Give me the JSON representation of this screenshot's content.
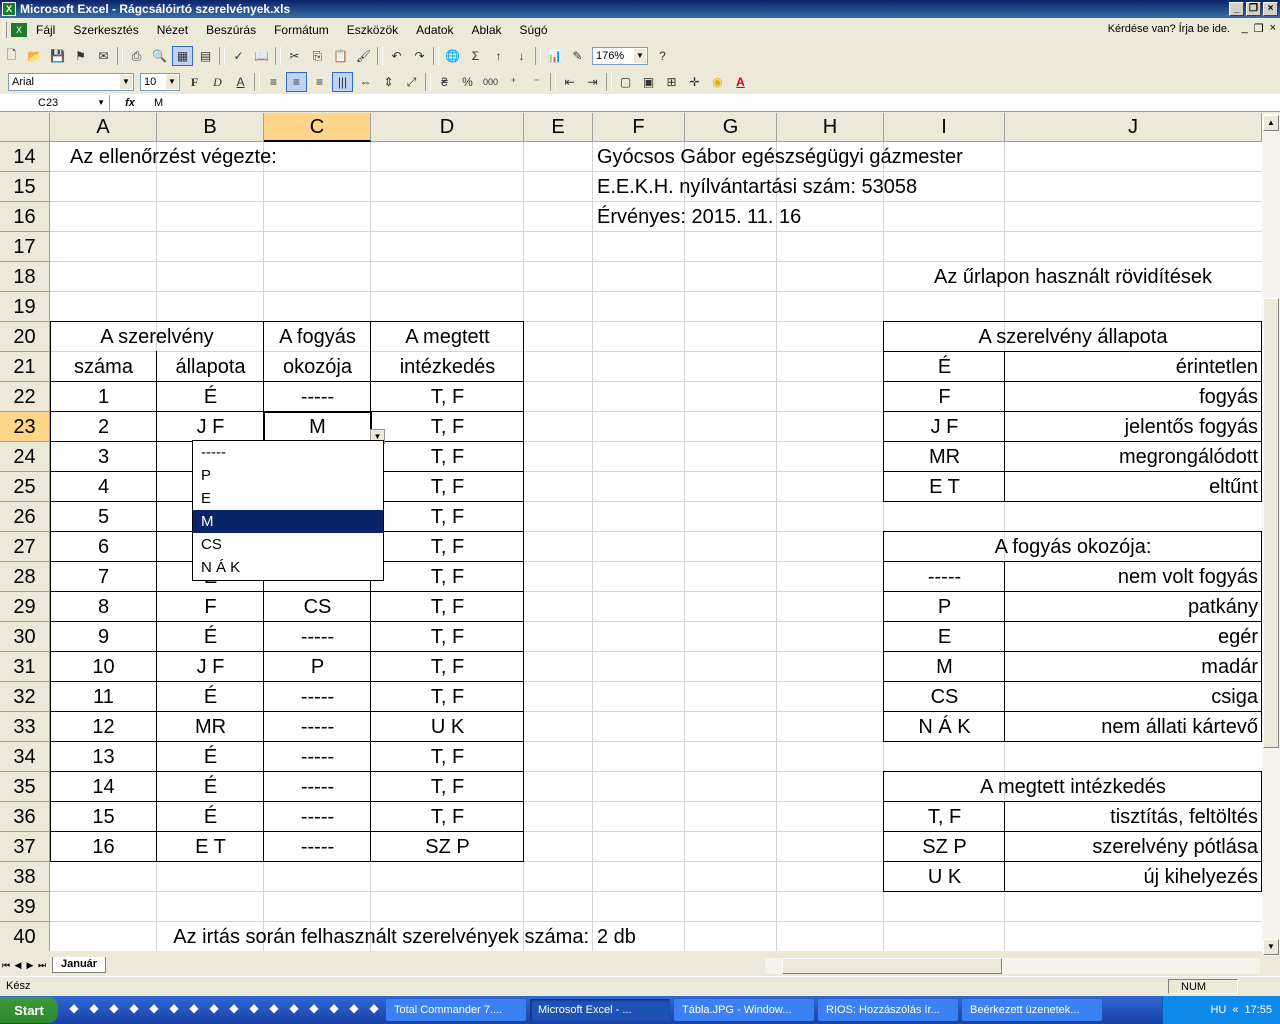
{
  "window": {
    "title": "Microsoft Excel - Rágcsálóirtó szerelvények.xls"
  },
  "menu": {
    "items": [
      "Fájl",
      "Szerkesztés",
      "Nézet",
      "Beszúrás",
      "Formátum",
      "Eszközök",
      "Adatok",
      "Ablak",
      "Súgó"
    ],
    "help_placeholder": "Kérdése van? Írja be ide."
  },
  "toolbar": {
    "zoom": "176%",
    "font": "Arial",
    "size": "10"
  },
  "formula": {
    "namebox": "C23",
    "fx": "fx",
    "content": "M"
  },
  "columns": [
    "A",
    "B",
    "C",
    "D",
    "E",
    "F",
    "G",
    "H",
    "I",
    "J"
  ],
  "rows": [
    "14",
    "15",
    "16",
    "17",
    "18",
    "19",
    "20",
    "21",
    "22",
    "23",
    "24",
    "25",
    "26",
    "27",
    "28",
    "29",
    "30",
    "31",
    "32",
    "33",
    "34",
    "35",
    "36",
    "37",
    "38",
    "39",
    "40"
  ],
  "header": {
    "ellenorzes": "Az ellenőrzést végezte:",
    "nev": "Gyócsos Gábor egészségügyi gázmester",
    "nyilv": "E.E.K.H. nyílvántartási szám: 53058",
    "ervenyes": "Érvényes: 2015. 11. 16",
    "rovid": "Az űrlapon használt rövidítések"
  },
  "table": {
    "h_szerelveny": "A szerelvény",
    "h_fogyas": "A fogyás",
    "h_megtett": "A megtett",
    "h_szama": "száma",
    "h_allapota": "állapota",
    "h_okozoja": "okozója",
    "h_intezkedes": "intézkedés",
    "rows": [
      [
        "1",
        "É",
        "-----",
        "T, F"
      ],
      [
        "2",
        "J F",
        "M",
        "T, F"
      ],
      [
        "3",
        "",
        "",
        "T, F"
      ],
      [
        "4",
        "",
        "",
        "T, F"
      ],
      [
        "5",
        "",
        "",
        "T, F"
      ],
      [
        "6",
        "",
        "",
        "T, F"
      ],
      [
        "7",
        "É",
        "",
        "T, F"
      ],
      [
        "8",
        "F",
        "CS",
        "T, F"
      ],
      [
        "9",
        "É",
        "-----",
        "T, F"
      ],
      [
        "10",
        "J F",
        "P",
        "T, F"
      ],
      [
        "11",
        "É",
        "-----",
        "T, F"
      ],
      [
        "12",
        "MR",
        "-----",
        "U K"
      ],
      [
        "13",
        "É",
        "-----",
        "T, F"
      ],
      [
        "14",
        "É",
        "-----",
        "T, F"
      ],
      [
        "15",
        "É",
        "-----",
        "T, F"
      ],
      [
        "16",
        "E T",
        "-----",
        "SZ P"
      ]
    ]
  },
  "legend": {
    "allapot_title": "A szerelvény állapota",
    "allapot": [
      [
        "É",
        "érintetlen"
      ],
      [
        "F",
        "fogyás"
      ],
      [
        "J F",
        "jelentős fogyás"
      ],
      [
        "MR",
        "megrongálódott"
      ],
      [
        "E T",
        "eltűnt"
      ]
    ],
    "okozo_title": "A fogyás okozója:",
    "okozo": [
      [
        "-----",
        "nem volt fogyás"
      ],
      [
        "P",
        "patkány"
      ],
      [
        "E",
        "egér"
      ],
      [
        "M",
        "madár"
      ],
      [
        "CS",
        "csiga"
      ],
      [
        "N Á K",
        "nem állati kártevő"
      ]
    ],
    "intezkedes_title": "A megtett intézkedés",
    "intezkedes": [
      [
        "T, F",
        "tisztítás, feltöltés"
      ],
      [
        "SZ P",
        "szerelvény pótlása"
      ],
      [
        "U K",
        "új kihelyezés"
      ]
    ]
  },
  "footer": {
    "label": "Az irtás során felhasznált szerelvények száma:",
    "value": "2 db"
  },
  "dropdown": {
    "options": [
      "-----",
      "P",
      "E",
      "M",
      "CS",
      "N Á K"
    ],
    "selected": "M"
  },
  "sheet": {
    "tab": "Január"
  },
  "status": {
    "left": "Kész",
    "num": "NUM"
  },
  "taskbar": {
    "start": "Start",
    "tasks": [
      "Total Commander 7....",
      "Microsoft Excel - ...",
      "Tábla.JPG - Window...",
      "RIOS: Hozzászólás ír...",
      "Beérkezett üzenetek..."
    ],
    "lang": "HU",
    "time": "17:55"
  }
}
